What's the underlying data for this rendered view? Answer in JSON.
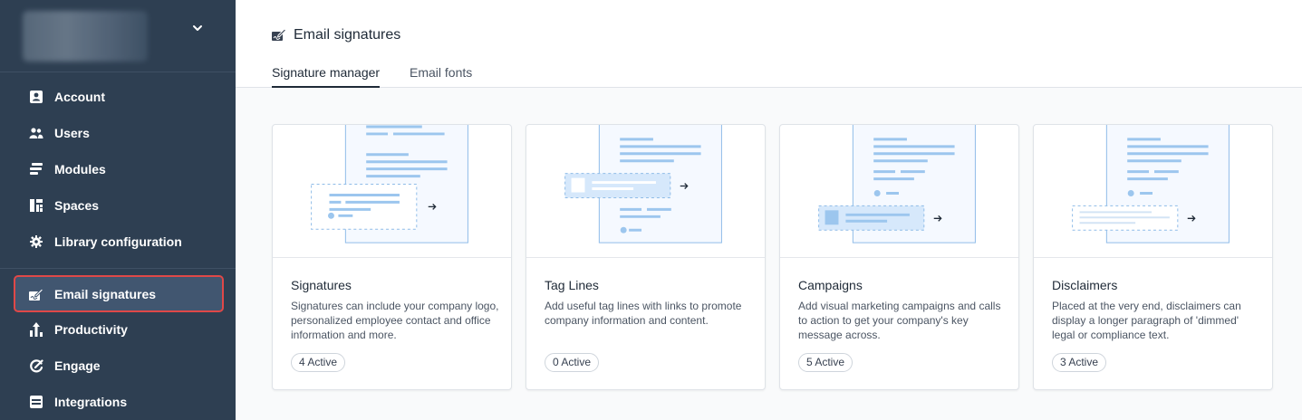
{
  "sidebar": {
    "items": [
      {
        "label": "Account",
        "icon": "account-icon"
      },
      {
        "label": "Users",
        "icon": "users-icon"
      },
      {
        "label": "Modules",
        "icon": "modules-icon"
      },
      {
        "label": "Spaces",
        "icon": "spaces-icon"
      },
      {
        "label": "Library configuration",
        "icon": "gear-icon"
      },
      {
        "label": "Email signatures",
        "icon": "signature-icon",
        "active": true
      },
      {
        "label": "Productivity",
        "icon": "productivity-icon"
      },
      {
        "label": "Engage",
        "icon": "engage-icon"
      },
      {
        "label": "Integrations",
        "icon": "integrations-icon"
      }
    ]
  },
  "header": {
    "title": "Email signatures",
    "tabs": [
      {
        "label": "Signature manager",
        "active": true
      },
      {
        "label": "Email fonts",
        "active": false
      }
    ]
  },
  "cards": [
    {
      "title": "Signatures",
      "description": "Signatures can include your company logo, personalized employee contact and office information and more.",
      "badge": "4 Active"
    },
    {
      "title": "Tag Lines",
      "description": "Add useful tag lines with links to promote company information and content.",
      "badge": "0 Active"
    },
    {
      "title": "Campaigns",
      "description": "Add visual marketing campaigns and calls to action to get your company's key message across.",
      "badge": "5 Active"
    },
    {
      "title": "Disclaimers",
      "description": "Placed at the very end, disclaimers can display a longer paragraph of 'dimmed' legal or compliance text.",
      "badge": "3 Active"
    }
  ],
  "colors": {
    "sidebar_bg": "#2e3f52",
    "active_item_bg": "#415670",
    "highlight_border": "#e04848",
    "illustration_blue": "#8fbce8"
  }
}
